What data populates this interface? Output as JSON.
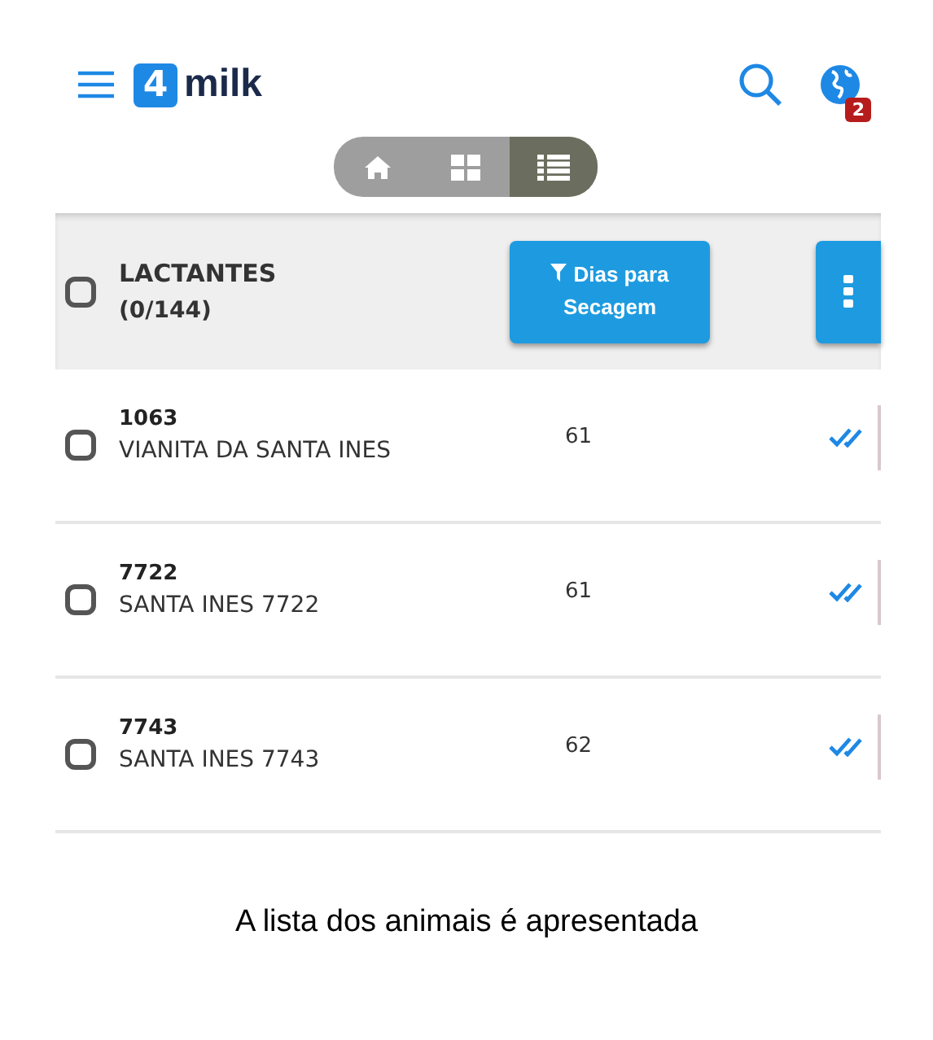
{
  "header": {
    "logo_mark": "4",
    "logo_text": "milk",
    "notification_count": "2"
  },
  "view_toggle": [
    {
      "kind": "home",
      "selected": false
    },
    {
      "kind": "grid",
      "selected": false
    },
    {
      "kind": "list",
      "selected": true
    }
  ],
  "list_header": {
    "checked": false,
    "title": "LACTANTES",
    "count": "(0/144)",
    "filter_button": "Dias para Secagem"
  },
  "rows": [
    {
      "checked": false,
      "id": "1063",
      "name": "VIANITA DA SANTA INES",
      "days": "61"
    },
    {
      "checked": false,
      "id": "7722",
      "name": "SANTA INES 7722",
      "days": "61"
    },
    {
      "checked": false,
      "id": "7743",
      "name": "SANTA INES 7743",
      "days": "62"
    }
  ],
  "caption": "A lista dos animais é apresentada"
}
